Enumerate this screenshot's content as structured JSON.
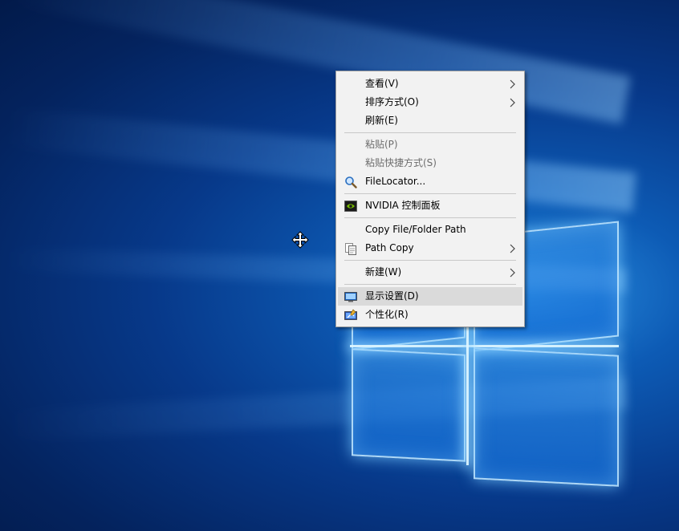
{
  "desktop": {
    "wallpaper": "windows-10-hero",
    "colors": {
      "bg_dark": "#04235e",
      "bg_mid": "#0d5bb5",
      "glow": "#8fd0ff"
    }
  },
  "cursor": {
    "icon": "move-cursor-icon"
  },
  "context_menu": {
    "items": [
      {
        "label": "查看(V)",
        "submenu": true
      },
      {
        "label": "排序方式(O)",
        "submenu": true
      },
      {
        "label": "刷新(E)"
      },
      {
        "label": "粘贴(P)",
        "disabled": true
      },
      {
        "label": "粘贴快捷方式(S)",
        "disabled": true
      },
      {
        "label": "FileLocator...",
        "icon": "magnifier-icon"
      },
      {
        "label": "NVIDIA 控制面板",
        "icon": "nvidia-icon"
      },
      {
        "label": "Copy File/Folder Path"
      },
      {
        "label": "Path Copy",
        "icon": "path-copy-icon",
        "submenu": true
      },
      {
        "label": "新建(W)",
        "submenu": true
      },
      {
        "label": "显示设置(D)",
        "icon": "display-icon",
        "highlighted": true
      },
      {
        "label": "个性化(R)",
        "icon": "personalize-icon"
      }
    ]
  }
}
